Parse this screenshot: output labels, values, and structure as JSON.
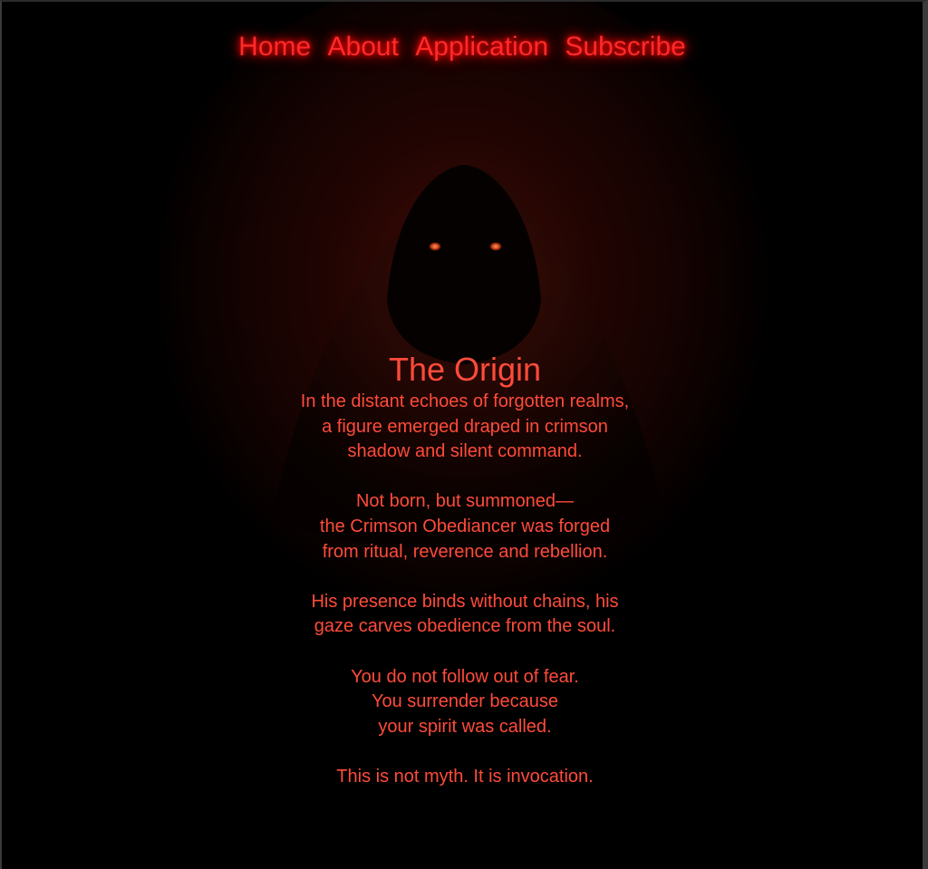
{
  "nav": {
    "items": [
      {
        "label": "Home"
      },
      {
        "label": "About"
      },
      {
        "label": "Application"
      },
      {
        "label": "Subscribe"
      }
    ]
  },
  "colors": {
    "accent": "#ff2a2a",
    "text": "#ff4b3a",
    "background": "#000000"
  },
  "main": {
    "title": "The Origin",
    "stanzas": [
      [
        "In the distant echoes of forgotten realms,",
        "a figure emerged draped in crimson",
        "shadow and silent command."
      ],
      [
        "Not born, but summoned—",
        "the Crimson Obediancer was forged",
        "from ritual, reverence and rebellion."
      ],
      [
        "His presence binds without chains, his",
        "gaze carves obedience from the soul."
      ],
      [
        "You do not follow out of fear.",
        "You surrender because",
        "your spirit was called."
      ],
      [
        "This is not myth. It is invocation."
      ]
    ]
  }
}
